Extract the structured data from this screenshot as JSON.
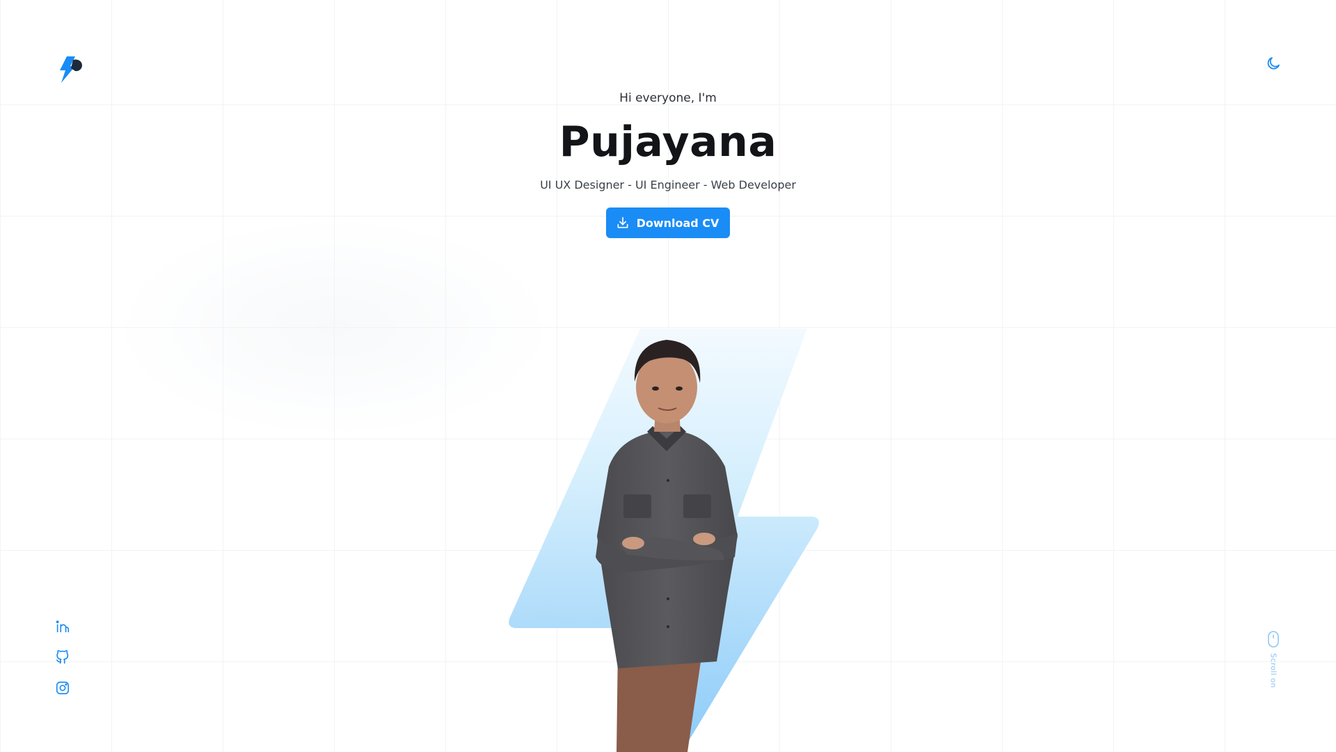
{
  "header": {
    "logo_icon": "lightning-logo-icon",
    "theme_toggle_icon": "moon-icon"
  },
  "hero": {
    "greeting": "Hi everyone, I'm",
    "name": "Pujayana",
    "roles": "UI UX Designer - UI Engineer - Web Developer",
    "cta_label": "Download CV",
    "cta_icon": "download-icon",
    "image_description": "portrait-photo"
  },
  "socials": [
    {
      "icon": "linkedin-icon"
    },
    {
      "icon": "github-icon"
    },
    {
      "icon": "instagram-icon"
    }
  ],
  "scroll": {
    "label": "Scroll on",
    "icon": "mouse-icon"
  },
  "colors": {
    "accent": "#1a8cf5",
    "bolt_light": "#d8f0fd",
    "bolt_mid": "#9fd5fb",
    "heading": "#121418",
    "text": "#2b2f36",
    "grid": "#f1f3f5"
  }
}
